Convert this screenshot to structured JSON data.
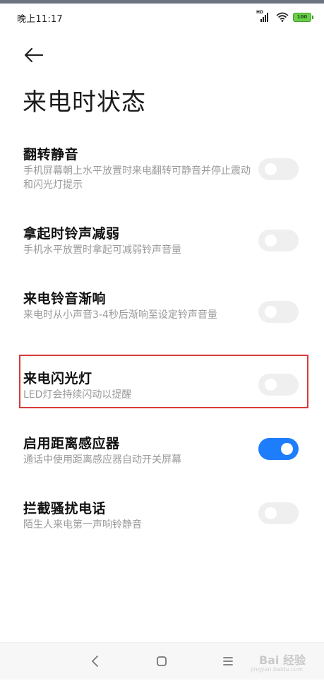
{
  "status_bar": {
    "time": "晚上11:17",
    "hd_label": "HD",
    "battery_level": "100",
    "icons": [
      "signal-icon",
      "wifi-icon",
      "battery-icon"
    ]
  },
  "header": {
    "title": "来电时状态"
  },
  "settings": [
    {
      "title": "翻转静音",
      "desc": "手机屏幕朝上水平放置时来电翻转可静音并停止震动和闪光灯提示",
      "enabled": false
    },
    {
      "title": "拿起时铃声减弱",
      "desc": "手机水平放置时拿起可减弱铃声音量",
      "enabled": false
    },
    {
      "title": "来电铃音渐响",
      "desc": "来电时从小声音3-4秒后渐响至设定铃声音量",
      "enabled": false
    },
    {
      "title": "来电闪光灯",
      "desc": "LED灯会持续闪动以提醒",
      "enabled": false
    },
    {
      "title": "启用距离感应器",
      "desc": "通话中使用距离感应器自动开关屏幕",
      "enabled": true
    },
    {
      "title": "拦截骚扰电话",
      "desc": "陌生人来电第一声响铃静音",
      "enabled": false
    }
  ],
  "nav_bar": {
    "icons": [
      "back-nav-icon",
      "home-nav-icon",
      "menu-nav-icon"
    ]
  },
  "watermark": {
    "text": "Bai 经验",
    "sub": "jingyan.baidu.com"
  },
  "colors": {
    "accent": "#1d7dfa",
    "highlight": "#d83a3a",
    "toggle_off": "#efefef"
  }
}
